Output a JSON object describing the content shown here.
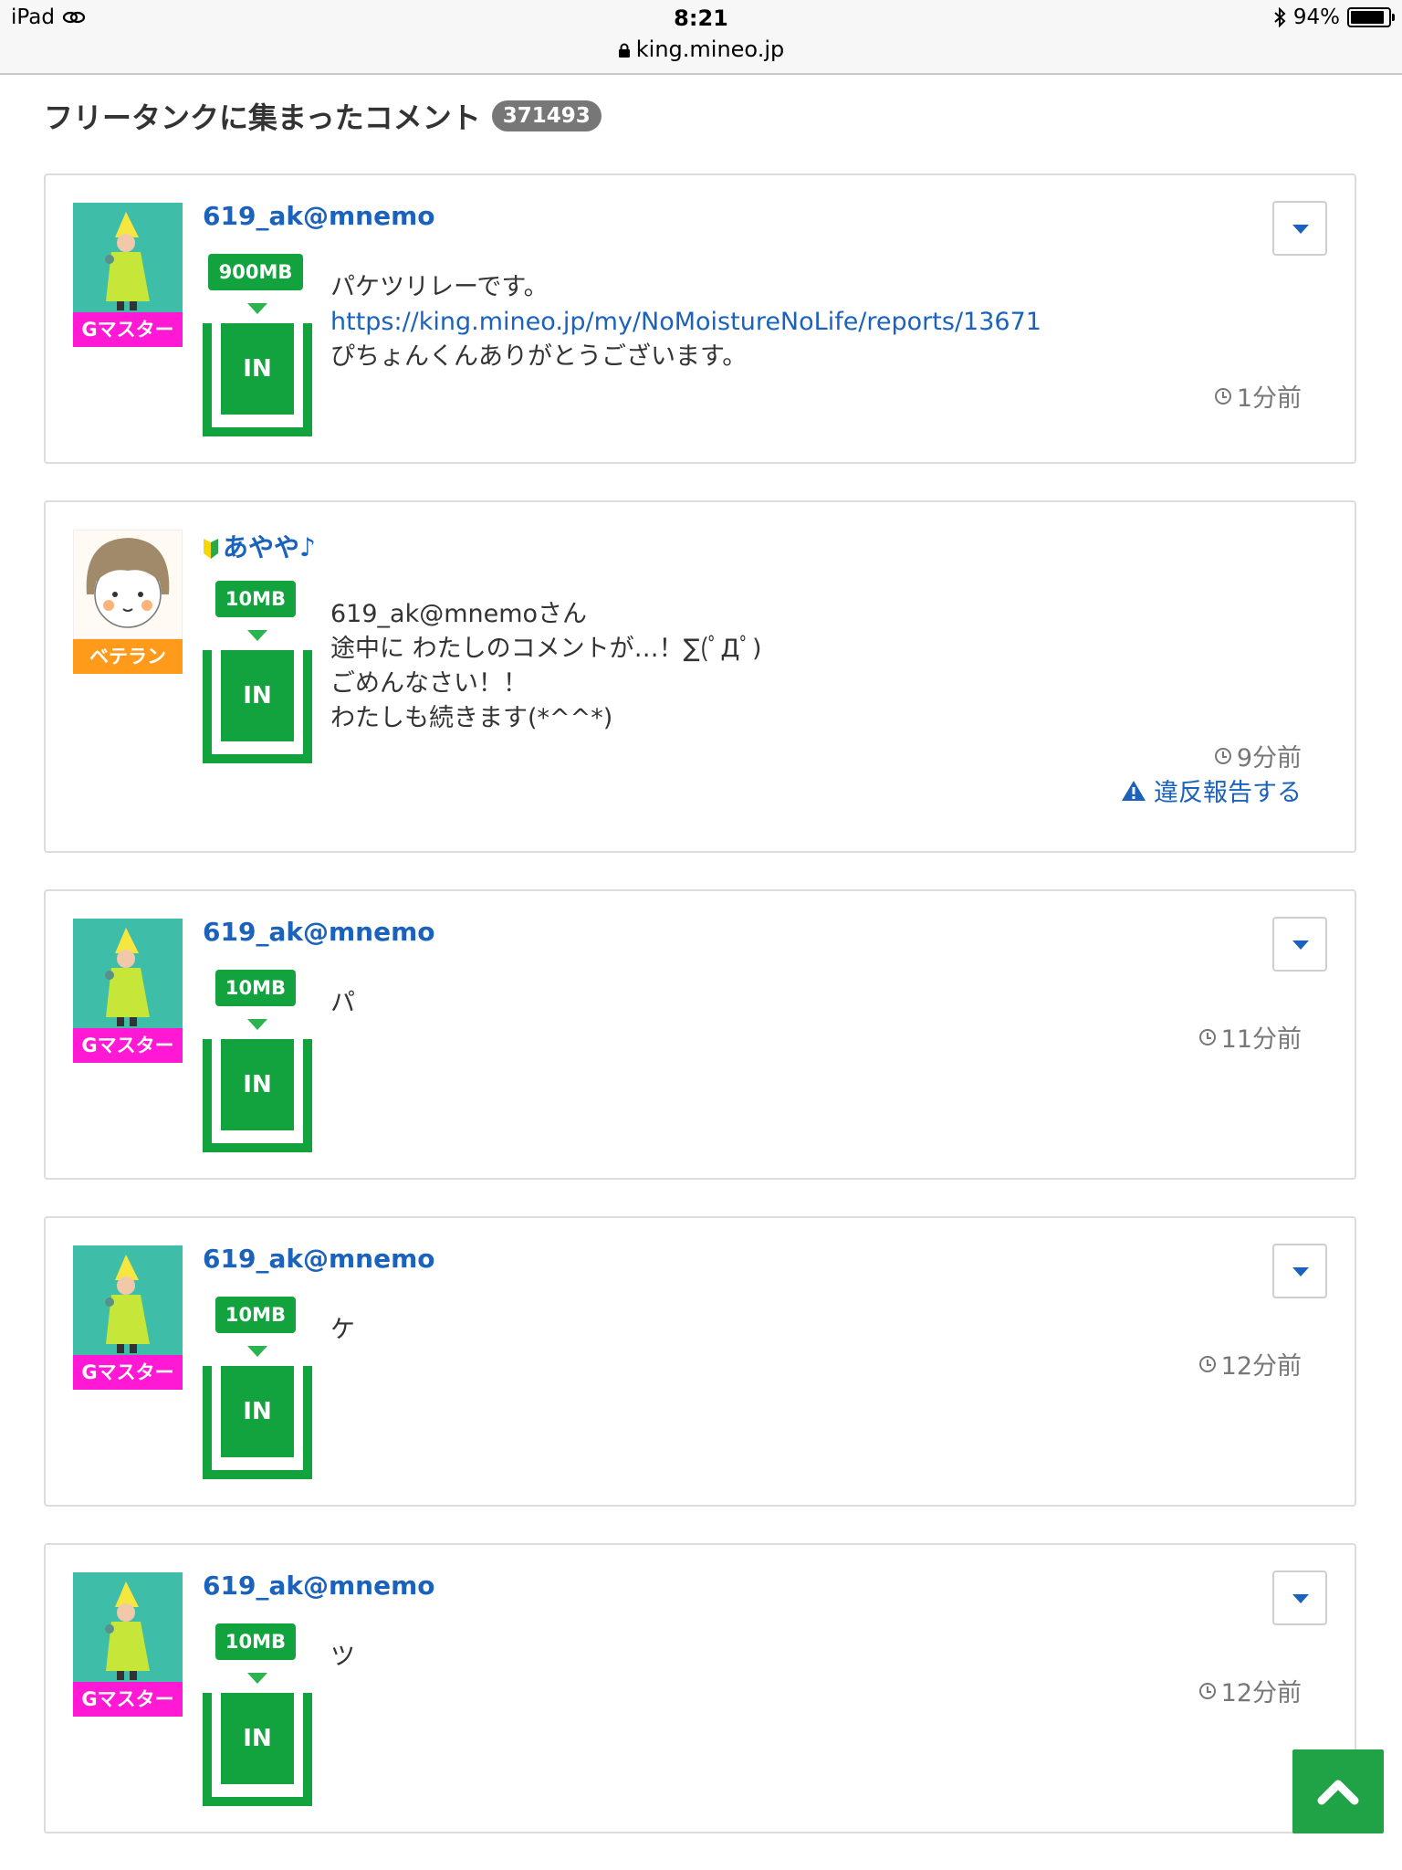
{
  "status_bar": {
    "device": "iPad",
    "time": "8:21",
    "url": "king.mineo.jp",
    "battery": "94%"
  },
  "heading": {
    "title": "フリータンクに集まったコメント",
    "count": "371493"
  },
  "comments": [
    {
      "user": "619_ak@mnemo",
      "rank": "Gマスター",
      "amount": "900MB",
      "in_label": "IN",
      "lines": [
        "パケツリレーです。",
        "https://king.mineo.jp/my/NoMoistureNoLife/reports/13671",
        "ぴちょんくんありがとうございます。"
      ],
      "time": "1分前"
    },
    {
      "user": "あやや♪",
      "rank": "ベテラン",
      "amount": "10MB",
      "in_label": "IN",
      "lines": [
        "619_ak@mnemoさん",
        "途中に わたしのコメントが…！∑(ﾟДﾟ)",
        "ごめんなさい！！",
        "わたしも続きます(*^^*)"
      ],
      "time": "9分前",
      "report": "違反報告する"
    },
    {
      "user": "619_ak@mnemo",
      "rank": "Gマスター",
      "amount": "10MB",
      "in_label": "IN",
      "lines": [
        "パ"
      ],
      "time": "11分前"
    },
    {
      "user": "619_ak@mnemo",
      "rank": "Gマスター",
      "amount": "10MB",
      "in_label": "IN",
      "lines": [
        "ケ"
      ],
      "time": "12分前"
    },
    {
      "user": "619_ak@mnemo",
      "rank": "Gマスター",
      "amount": "10MB",
      "in_label": "IN",
      "lines": [
        "ツ"
      ],
      "time": "12分前"
    }
  ],
  "colors": {
    "accent_green": "#12a33f",
    "link_blue": "#1b62bc",
    "rank_gmaster": "#ff19d4",
    "rank_veteran": "#ff9a1a"
  },
  "icons": {
    "menu": "chevron-down-icon",
    "time": "clock-icon",
    "report": "warning-icon",
    "scroll": "chevron-up-icon"
  }
}
